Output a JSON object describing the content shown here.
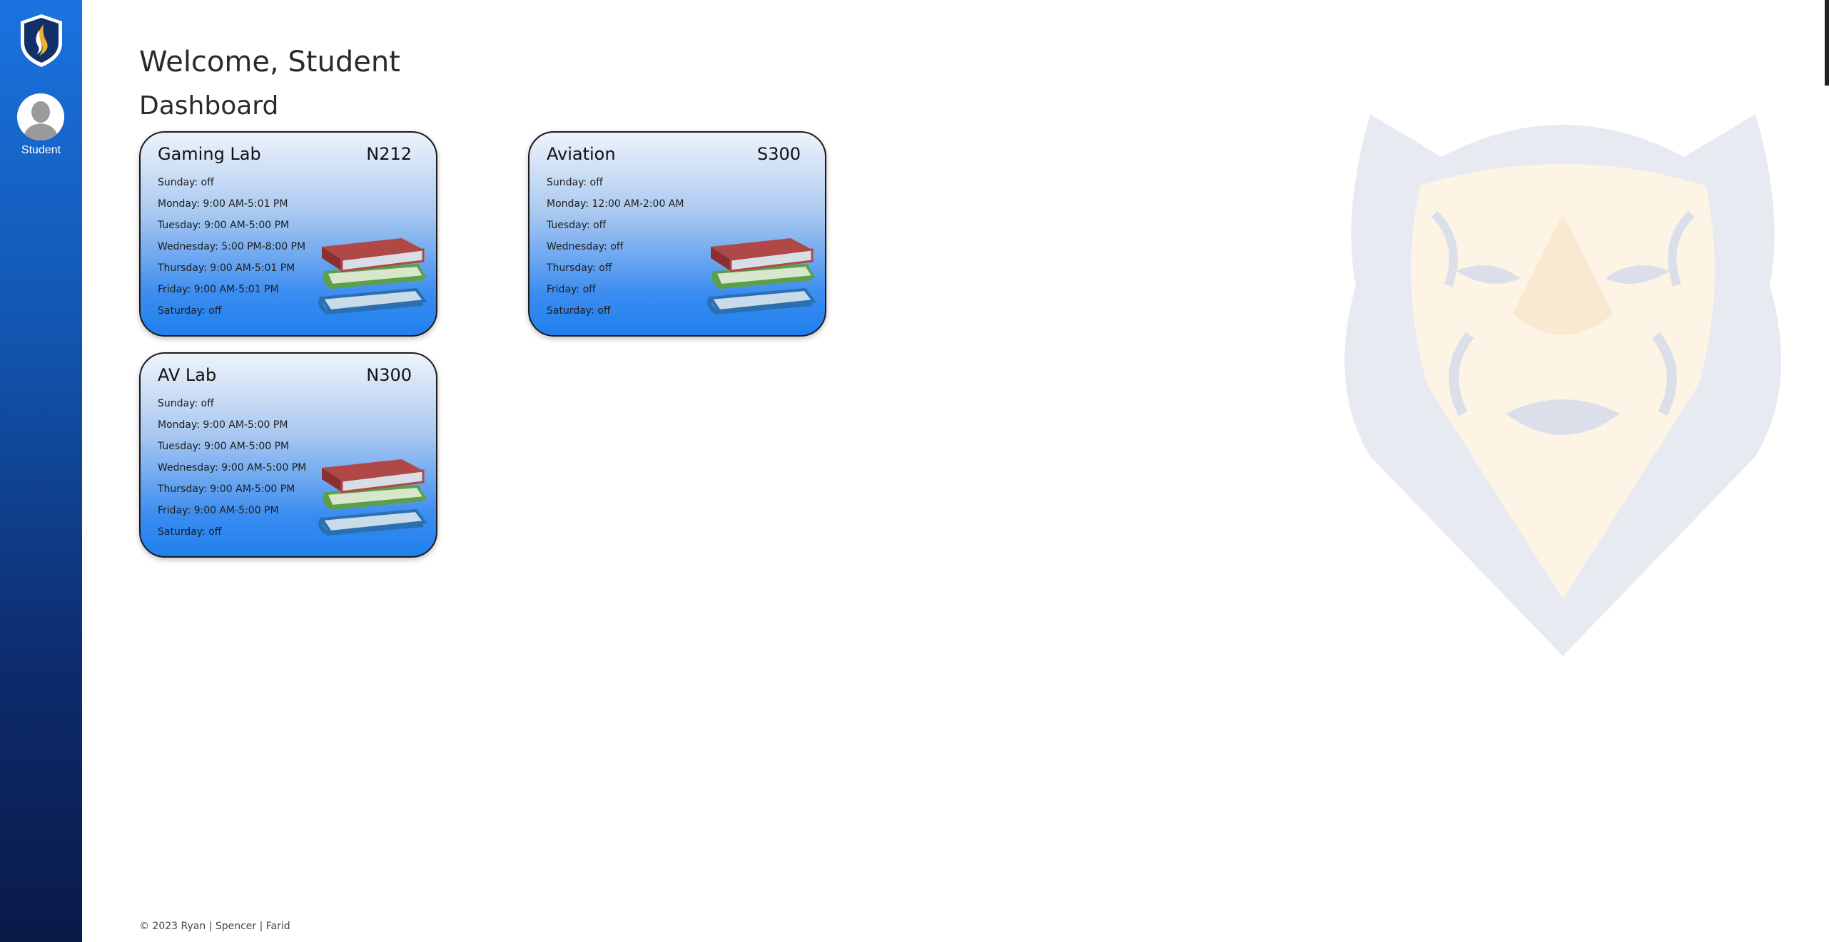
{
  "sidebar": {
    "user_label": "Student"
  },
  "header": {
    "welcome": "Welcome, Student",
    "section_title": "Dashboard"
  },
  "labs": [
    {
      "name": "Gaming Lab",
      "room": "N212",
      "hours": [
        "Sunday: off",
        "Monday: 9:00 AM-5:01 PM",
        "Tuesday: 9:00 AM-5:00 PM",
        "Wednesday: 5:00 PM-8:00 PM",
        "Thursday: 9:00 AM-5:01 PM",
        "Friday: 9:00 AM-5:01 PM",
        "Saturday: off"
      ]
    },
    {
      "name": "Aviation",
      "room": "S300",
      "hours": [
        "Sunday: off",
        "Monday: 12:00 AM-2:00 AM",
        "Tuesday: off",
        "Wednesday: off",
        "Thursday: off",
        "Friday: off",
        "Saturday: off"
      ]
    },
    {
      "name": "AV Lab",
      "room": "N300",
      "hours": [
        "Sunday: off",
        "Monday: 9:00 AM-5:00 PM",
        "Tuesday: 9:00 AM-5:00 PM",
        "Wednesday: 9:00 AM-5:00 PM",
        "Thursday: 9:00 AM-5:00 PM",
        "Friday: 9:00 AM-5:00 PM",
        "Saturday: off"
      ]
    }
  ],
  "footer": {
    "text": "© 2023 Ryan | Spencer | Farid"
  },
  "colors": {
    "sidebar_top": "#1a73e0",
    "sidebar_bottom": "#0a1a48",
    "card_bottom": "#1f80ee"
  },
  "icons": [
    "flame-shield-logo-icon",
    "user-avatar-icon",
    "books-stack-icon",
    "tiger-watermark"
  ]
}
